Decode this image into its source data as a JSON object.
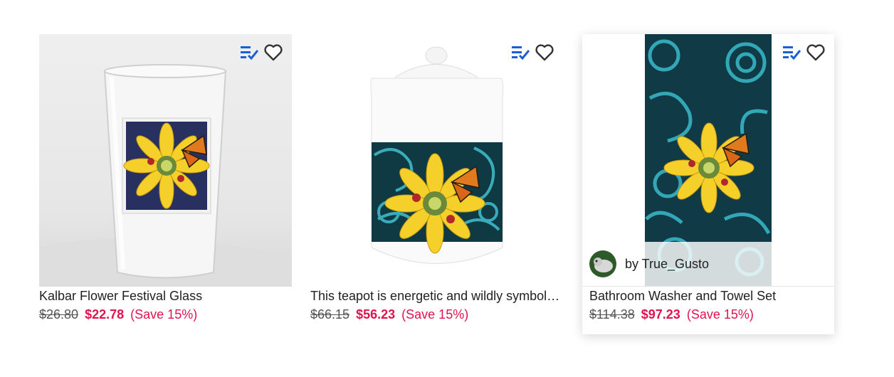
{
  "products": [
    {
      "title": "Kalbar Flower Festival Glass",
      "original_price": "$26.80",
      "sale_price": "$22.78",
      "save_text": "(Save 15%)"
    },
    {
      "title": "This teapot is energetic and wildly symbol…",
      "original_price": "$66.15",
      "sale_price": "$56.23",
      "save_text": "(Save 15%)"
    },
    {
      "title": "Bathroom Washer and Towel Set",
      "original_price": "$114.38",
      "sale_price": "$97.23",
      "save_text": "(Save 15%)",
      "creator": "by True_Gusto"
    }
  ],
  "icons": {
    "add_to_list": "add-to-list-icon",
    "favorite": "heart-outline-icon"
  },
  "colors": {
    "sale_red": "#e0134e",
    "list_icon_blue": "#1a5fd6"
  }
}
